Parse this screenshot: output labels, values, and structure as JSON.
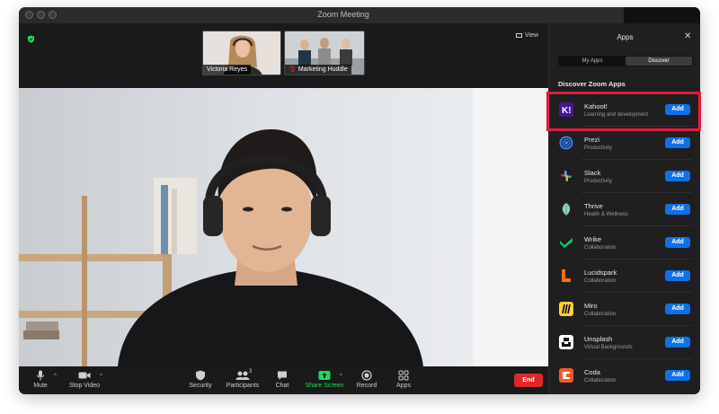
{
  "window": {
    "title": "Zoom Meeting"
  },
  "thumbnails": [
    {
      "name": "Victoria Reyes"
    },
    {
      "name": "Marketing Huddle"
    }
  ],
  "view_label": "View",
  "toolbar": {
    "mute": "Mute",
    "stop_video": "Stop Video",
    "security": "Security",
    "participants": "Participants",
    "participants_count": "3",
    "chat": "Chat",
    "share_screen": "Share Screen",
    "record": "Record",
    "apps": "Apps",
    "end": "End"
  },
  "apps_panel": {
    "title": "Apps",
    "tabs": [
      "My Apps",
      "Discover"
    ],
    "active_tab": "Discover",
    "section_title": "Discover Zoom Apps",
    "add_label": "Add",
    "apps": [
      {
        "name": "Kahoot!",
        "category": "Learning and development",
        "icon": "kahoot-icon"
      },
      {
        "name": "Prezi",
        "category": "Productivity",
        "icon": "prezi-icon"
      },
      {
        "name": "Slack",
        "category": "Productivity",
        "icon": "slack-icon"
      },
      {
        "name": "Thrive",
        "category": "Health & Wellness",
        "icon": "thrive-icon"
      },
      {
        "name": "Wrike",
        "category": "Collaboration",
        "icon": "wrike-icon"
      },
      {
        "name": "Lucidspark",
        "category": "Collaboration",
        "icon": "lucidspark-icon"
      },
      {
        "name": "Miro",
        "category": "Collaboration",
        "icon": "miro-icon"
      },
      {
        "name": "Unsplash",
        "category": "Virtual Backgrounds",
        "icon": "unsplash-icon"
      },
      {
        "name": "Coda",
        "category": "Collaboration",
        "icon": "coda-icon"
      }
    ]
  },
  "colors": {
    "accent_blue": "#0e71eb",
    "end_red": "#e02828",
    "share_green": "#23d959",
    "highlight_red": "#e5193d"
  }
}
